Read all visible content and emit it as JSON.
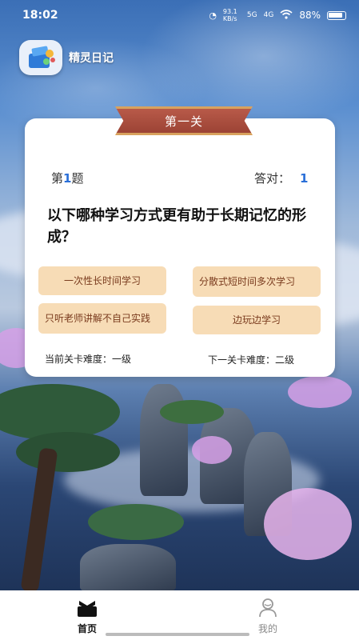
{
  "status_bar": {
    "time": "18:02",
    "net_speed": "93.1 KB/s",
    "signal_1": "5G",
    "signal_2": "4G",
    "battery": "88%"
  },
  "app": {
    "name": "精灵日记"
  },
  "quiz": {
    "level_title": "第一关",
    "question_prefix": "第",
    "question_number": "1",
    "question_suffix": "题",
    "correct_label": "答对：",
    "correct_count": "1",
    "question": "以下哪种学习方式更有助于长期记忆的形成？",
    "options": [
      {
        "label": "一次性长时间学习"
      },
      {
        "label": "分散式短时间多次学习"
      },
      {
        "label": "只听老师讲解不自己实践"
      },
      {
        "label": "边玩边学习"
      }
    ],
    "current_difficulty": "当前关卡难度：一级",
    "next_difficulty": "下一关卡难度：二级"
  },
  "nav": {
    "items": [
      {
        "label": "首页",
        "icon": "home-icon",
        "active": true
      },
      {
        "label": "我的",
        "icon": "profile-icon",
        "active": false
      }
    ]
  },
  "colors": {
    "option_bg": "#f7dcb6",
    "option_text": "#7a3b1e",
    "ribbon": "#a84a3a",
    "accent_number": "#2a6fd8"
  }
}
